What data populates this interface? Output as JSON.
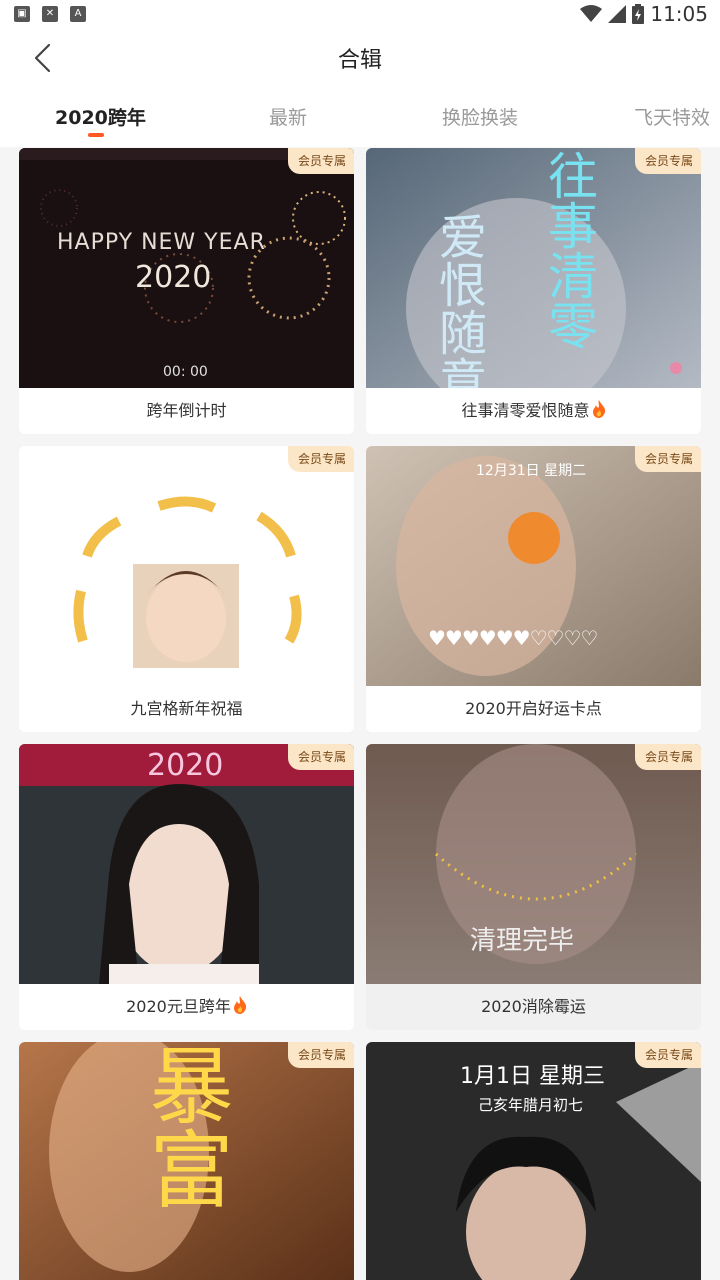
{
  "status_bar": {
    "time": "11:05"
  },
  "header": {
    "title": "合辑"
  },
  "tabs": [
    {
      "label": "2020跨年",
      "active": true
    },
    {
      "label": "最新",
      "active": false
    },
    {
      "label": "换脸换装",
      "active": false
    },
    {
      "label": "飞天特效",
      "active": false
    }
  ],
  "accent_color": "#ff5a24",
  "badge_label": "会员专属",
  "cards": [
    {
      "caption": "跨年倒计时",
      "hot": false,
      "overlay": [
        "HAPPY NEW YEAR",
        "2020",
        "00: 00"
      ]
    },
    {
      "caption": "往事清零爱恨随意",
      "hot": true,
      "overlay": [
        "往事清零",
        "爱恨随意"
      ]
    },
    {
      "caption": "九宫格新年祝福",
      "hot": false,
      "overlay": []
    },
    {
      "caption": "2020开启好运卡点",
      "hot": false,
      "overlay": [
        "12月31日 星期二",
        "♥♥♥♥♥♥♡♡♡♡"
      ]
    },
    {
      "caption": "2020元旦跨年",
      "hot": true,
      "overlay": [
        "2020"
      ]
    },
    {
      "caption": "2020消除霉运",
      "hot": false,
      "overlay": [
        "清理完毕"
      ]
    },
    {
      "caption": "",
      "hot": false,
      "overlay": [
        "暴",
        "富"
      ]
    },
    {
      "caption": "",
      "hot": false,
      "overlay": [
        "1月1日 星期三",
        "己亥年腊月初七"
      ]
    }
  ]
}
